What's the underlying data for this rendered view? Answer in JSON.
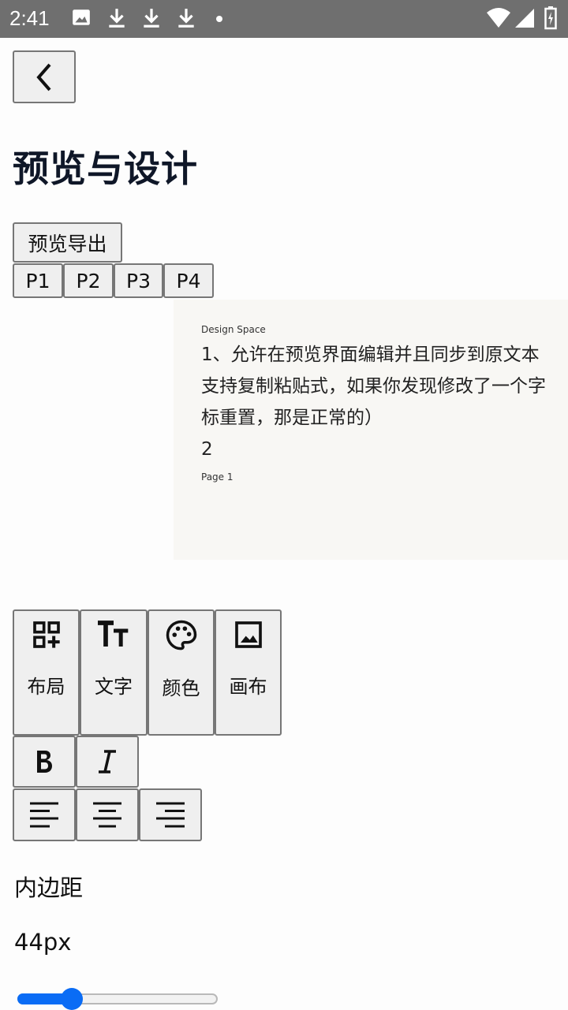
{
  "status_bar": {
    "time": "2:41",
    "icons": [
      "image-icon",
      "download-icon",
      "download-icon",
      "download-icon",
      "dot-icon",
      "wifi-icon",
      "signal-icon",
      "battery-icon"
    ]
  },
  "header": {
    "back_icon": "chevron-left-icon",
    "title": "预览与设计"
  },
  "export_button": "预览导出",
  "pages": [
    "P1",
    "P2",
    "P3",
    "P4"
  ],
  "preview": {
    "header_label": "Design Space",
    "lines": [
      "1、允许在预览界面编辑并且同步到原文本",
      "支持复制粘贴式，如果你发现修改了一个字",
      "标重置，那是正常的）",
      "2"
    ],
    "footer_label": "Page 1",
    "background": "#f8f7f4"
  },
  "tools": [
    {
      "icon": "add-grid-icon",
      "label": "布局"
    },
    {
      "icon": "text-size-icon",
      "label": "文字"
    },
    {
      "icon": "palette-icon",
      "label": "颜色"
    },
    {
      "icon": "image-icon",
      "label": "画布"
    }
  ],
  "format_buttons": [
    "bold-icon",
    "italic-icon"
  ],
  "align_buttons": [
    "align-left-icon",
    "align-center-icon",
    "align-right-icon"
  ],
  "padding": {
    "label": "内边距",
    "value": "44px",
    "slider_fraction": 0.27
  },
  "colors": {
    "accent": "#0a6cf5",
    "status_bar": "#6f6f6f",
    "title": "#0f1728",
    "button_bg": "#efefef"
  }
}
